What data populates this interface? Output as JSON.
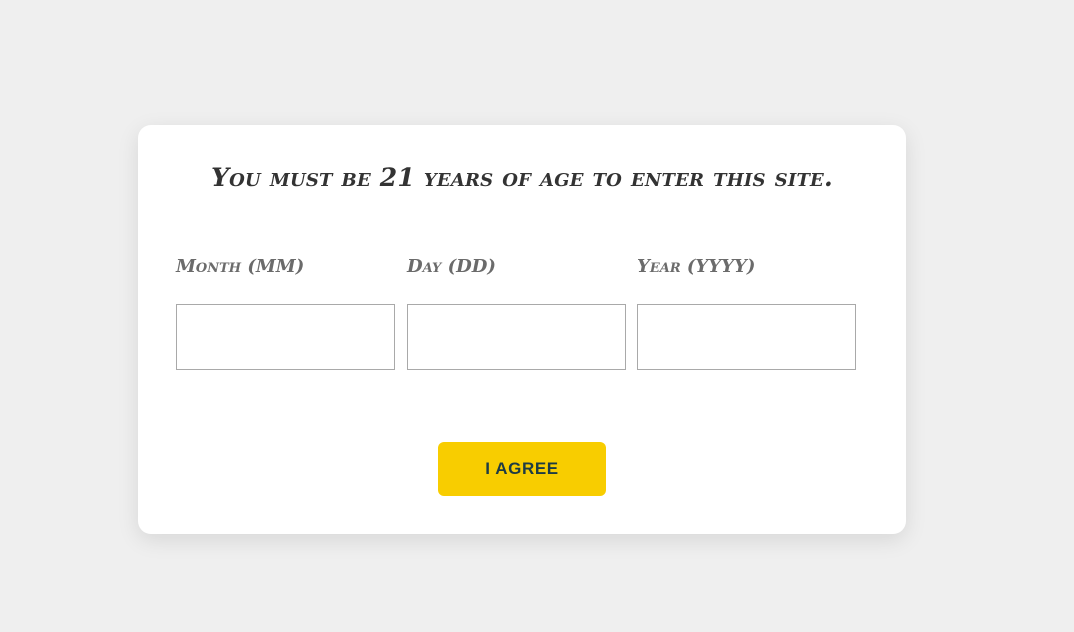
{
  "modal": {
    "title": "You must be 21 years of age to enter this site.",
    "fields": [
      {
        "label": "Month (MM)",
        "value": "",
        "placeholder": ""
      },
      {
        "label": "Day (DD)",
        "value": "",
        "placeholder": ""
      },
      {
        "label": "Year (YYYY)",
        "value": "",
        "placeholder": ""
      }
    ],
    "agree_label": "I AGREE"
  },
  "colors": {
    "page_background": "#efefef",
    "card_background": "#ffffff",
    "title_text": "#333333",
    "label_text": "#6b6b6b",
    "button_background": "#f8cd00",
    "button_text": "#1d3b44"
  }
}
